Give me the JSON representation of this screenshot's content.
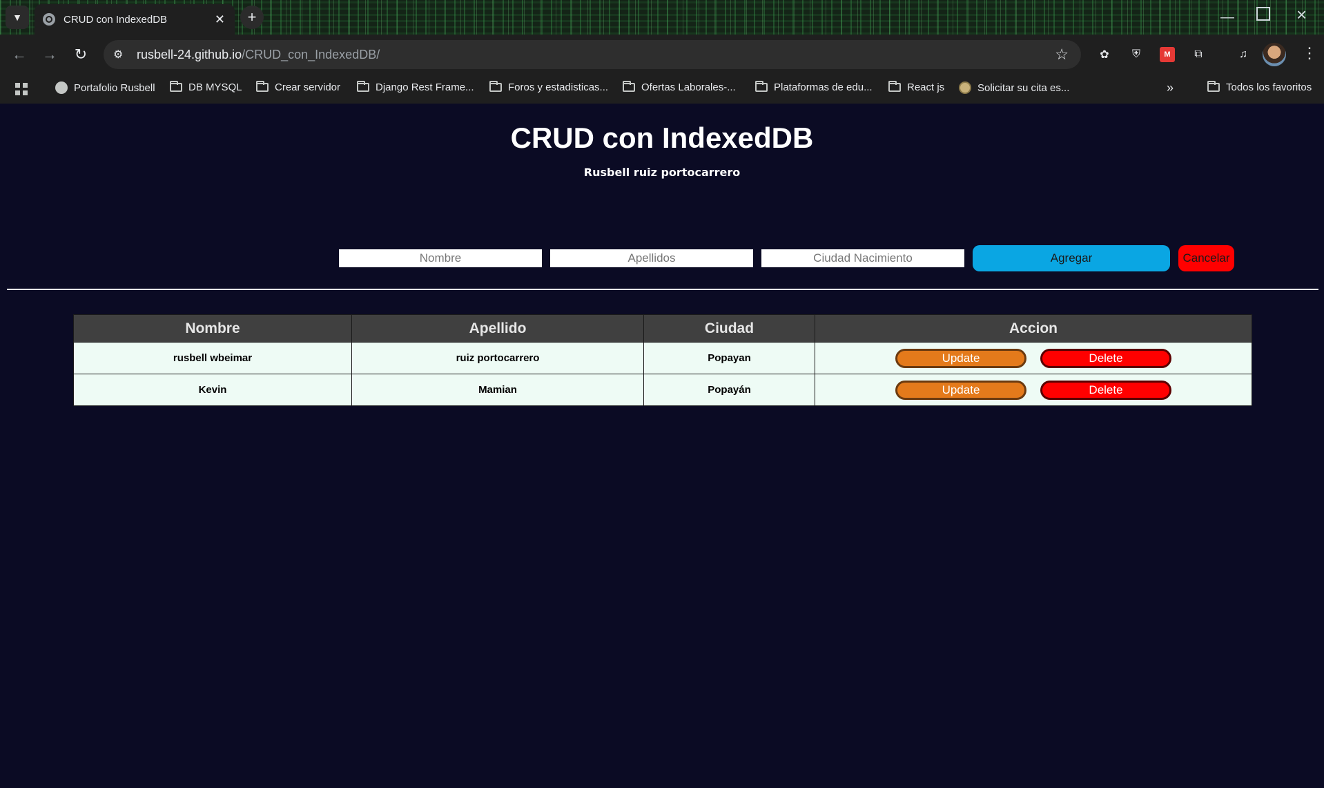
{
  "browser": {
    "tab_title": "CRUD con IndexedDB",
    "url_domain": "rusbell-24.github.io",
    "url_path": "/CRUD_con_IndexedDB/",
    "bookmarks": [
      {
        "label": "Portafolio Rusbell",
        "icon": "globe-icon"
      },
      {
        "label": "DB MYSQL",
        "icon": "folder-icon"
      },
      {
        "label": "Crear servidor",
        "icon": "folder-icon"
      },
      {
        "label": "Django Rest Frame...",
        "icon": "folder-icon"
      },
      {
        "label": "Foros y estadisticas...",
        "icon": "folder-icon"
      },
      {
        "label": "Ofertas Laborales-...",
        "icon": "folder-icon"
      },
      {
        "label": "Plataformas de edu...",
        "icon": "folder-icon"
      },
      {
        "label": "React js",
        "icon": "folder-icon"
      },
      {
        "label": "Solicitar su cita es...",
        "icon": "seal-icon"
      }
    ],
    "all_bookmarks": "Todos los favoritos"
  },
  "page": {
    "title": "CRUD con IndexedDB",
    "subtitle": "Rusbell ruiz portocarrero"
  },
  "form": {
    "nombre_placeholder": "Nombre",
    "apellidos_placeholder": "Apellidos",
    "ciudad_placeholder": "Ciudad Nacimiento",
    "agregar_label": "Agregar",
    "cancelar_label": "Cancelar"
  },
  "table": {
    "headers": [
      "Nombre",
      "Apellido",
      "Ciudad",
      "Accion"
    ],
    "rows": [
      {
        "nombre": "rusbell wbeimar",
        "apellido": "ruiz portocarrero",
        "ciudad": "Popayan"
      },
      {
        "nombre": "Kevin",
        "apellido": "Mamian",
        "ciudad": "Popayán"
      }
    ],
    "update_label": "Update",
    "delete_label": "Delete"
  },
  "colors": {
    "background": "#0b0b24",
    "agregar": "#0aa6e3",
    "cancelar": "#ff0000",
    "update": "#e47a1b",
    "delete": "#ff0000",
    "header": "#404040",
    "row": "#eefbf5"
  }
}
